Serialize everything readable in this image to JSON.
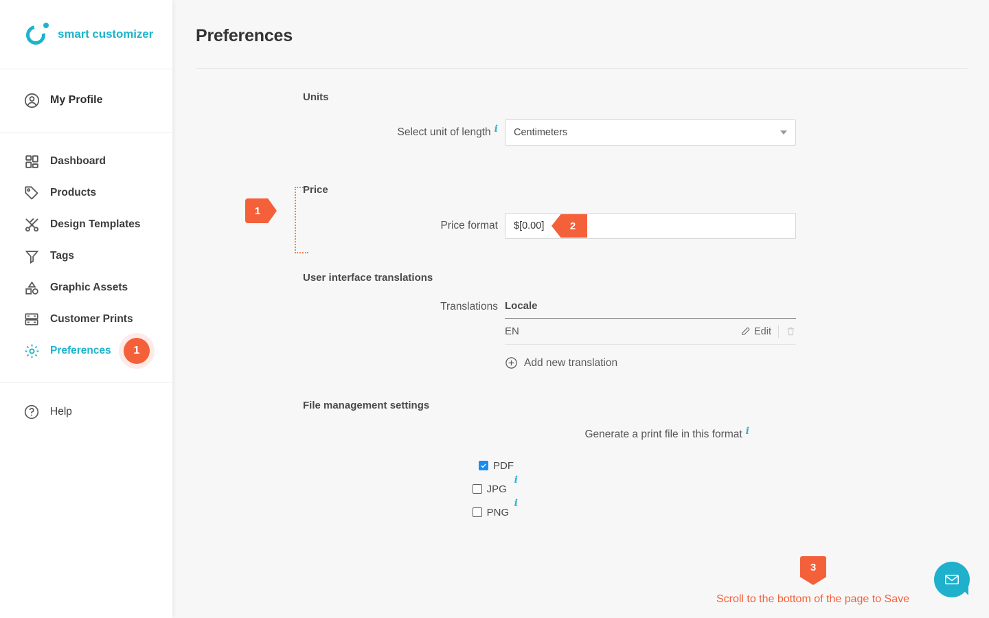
{
  "brand": {
    "name": "smart customizer",
    "color": "#1eb3cc"
  },
  "sidebar": {
    "profile": {
      "label": "My Profile",
      "icon": "user-circle-icon"
    },
    "groups": [
      {
        "items": [
          {
            "label": "Dashboard",
            "icon": "dashboard-grid-icon",
            "active": false
          },
          {
            "label": "Products",
            "icon": "tag-icon",
            "active": false
          },
          {
            "label": "Design Templates",
            "icon": "design-tools-icon",
            "active": false
          },
          {
            "label": "Tags",
            "icon": "funnel-icon",
            "active": false
          },
          {
            "label": "Graphic Assets",
            "icon": "shapes-icon",
            "active": false
          },
          {
            "label": "Customer Prints",
            "icon": "print-rows-icon",
            "active": false
          },
          {
            "label": "Preferences",
            "icon": "gear-icon",
            "active": true,
            "badge": "1"
          }
        ]
      }
    ],
    "help": {
      "label": "Help",
      "icon": "question-circle-icon"
    }
  },
  "main": {
    "page_title": "Preferences",
    "units": {
      "heading": "Units",
      "unit_label": "Select unit of length",
      "unit_value": "Centimeters",
      "info_icon": "info-icon"
    },
    "price": {
      "heading": "Price",
      "format_label": "Price format",
      "format_value": "$[0.00]",
      "step_badge_section": "1",
      "step_badge_field": "2"
    },
    "translations": {
      "heading": "User interface translations",
      "row_label": "Translations",
      "column_header": "Locale",
      "rows": [
        {
          "locale": "EN",
          "edit_label": "Edit",
          "edit_icon": "pencil-icon",
          "delete_icon": "trash-icon"
        }
      ],
      "add_label": "Add new translation",
      "add_icon": "plus-circle-icon"
    },
    "files": {
      "heading": "File management settings",
      "format_label": "Generate a print file in this format",
      "options": [
        {
          "label": "PDF",
          "checked": true,
          "has_info": false
        },
        {
          "label": "JPG",
          "checked": false,
          "has_info": true
        },
        {
          "label": "PNG",
          "checked": false,
          "has_info": true
        }
      ]
    },
    "scroll_note": "Scroll to the bottom of the page to Save",
    "step_badge_scroll": "3",
    "chat_icon": "envelope-icon"
  },
  "colors": {
    "accent_orange": "#f4603a",
    "brand_teal": "#1eb3cc",
    "checkbox_blue": "#1a8cf0"
  }
}
